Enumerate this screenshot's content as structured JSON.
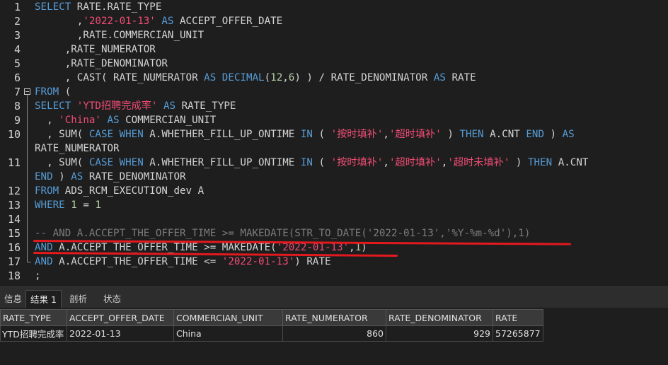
{
  "editor": {
    "line_numbers": [
      "1",
      "2",
      "3",
      "4",
      "5",
      "6",
      "7",
      "8",
      "9",
      "10",
      "",
      "11",
      "",
      "12",
      "13",
      "14",
      "15",
      "16",
      "17",
      "18"
    ],
    "lines": {
      "l1_kw": "SELECT",
      "l1_rest": " RATE.RATE_TYPE",
      "l2_pre": "       ,",
      "l2_str": "'2022-01-13'",
      "l2_as": " AS",
      "l2_rest": " ACCEPT_OFFER_DATE",
      "l3": "       ,RATE.COMMERCIAN_UNIT",
      "l4": "     ,RATE_NUMERATOR",
      "l5": "     ,RATE_DENOMINATOR",
      "l6_a": "     , CAST( RATE_NUMERATOR ",
      "l6_as": "AS",
      "l6_dec": " DECIMAL",
      "l6_b": "(",
      "l6_n1": "12",
      "l6_c": ",",
      "l6_n2": "6",
      "l6_d": ") ) / RATE_DENOMINATOR ",
      "l6_as2": "AS",
      "l6_e": " RATE",
      "l7_kw": "FROM",
      "l7_rest": " (",
      "l8_kw": "SELECT",
      "l8_str": " 'YTD招聘完成率'",
      "l8_as": " AS",
      "l8_rest": " RATE_TYPE",
      "l9_pre": "  , ",
      "l9_str": "'China'",
      "l9_as": " AS",
      "l9_rest": " COMMERCIAN_UNIT",
      "l10_a": "  , SUM( ",
      "l10_case": "CASE WHEN",
      "l10_b": " A.WHETHER_FILL_UP_ONTIME ",
      "l10_in": "IN",
      "l10_c": " ( ",
      "l10_s1": "'按时填补'",
      "l10_d": ",",
      "l10_s2": "'超时填补'",
      "l10_e": " ) ",
      "l10_then": "THEN",
      "l10_f": " A.CNT ",
      "l10_end": "END",
      "l10_g": " ) ",
      "l10_as": "AS",
      "l10w": "RATE_NUMERATOR",
      "l11_a": "  , SUM( ",
      "l11_case": "CASE WHEN",
      "l11_b": " A.WHETHER_FILL_UP_ONTIME ",
      "l11_in": "IN",
      "l11_c": " ( ",
      "l11_s1": "'按时填补'",
      "l11_d": ",",
      "l11_s2": "'超时填补'",
      "l11_e": ",",
      "l11_s3": "'超时未填补'",
      "l11_f": " ) ",
      "l11_then": "THEN",
      "l11_g": " A.CNT",
      "l11w_end": "END",
      "l11w_rest": " ) ",
      "l11w_as": "AS",
      "l11w_tail": " RATE_DENOMINATOR",
      "l12_kw": "FROM",
      "l12_rest": " ADS_RCM_EXECUTION_dev A",
      "l13_kw": "WHERE",
      "l13_sp": " ",
      "l13_n1": "1",
      "l13_eq": " = ",
      "l13_n2": "1",
      "l15": "-- AND A.ACCEPT_THE_OFFER_TIME >= MAKEDATE(STR_TO_DATE('2022-01-13','%Y-%m-%d'),1)",
      "l16_and": "AND",
      "l16_a": " A.ACCEPT_THE_OFFER_TIME >= MAKEDATE(",
      "l16_str": "'2022-01-13'",
      "l16_b": ",",
      "l16_n": "1",
      "l16_c": ")",
      "l17_and": "AND",
      "l17_a": " A.ACCEPT_THE_OFFER_TIME <= ",
      "l17_str": "'2022-01-13'",
      "l17_b": ") RATE",
      "l18": ";"
    }
  },
  "tabs": [
    {
      "label": "信息"
    },
    {
      "label": "结果 1"
    },
    {
      "label": "剖析"
    },
    {
      "label": "状态"
    }
  ],
  "results": {
    "headers": [
      "RATE_TYPE",
      "ACCEPT_OFFER_DATE",
      "COMMERCIAN_UNIT",
      "RATE_NUMERATOR",
      "RATE_DENOMINATOR",
      "RATE"
    ],
    "row": [
      "YTD招聘完成率",
      "2022-01-13",
      "China",
      "860",
      "929",
      "57265877"
    ]
  },
  "colors": {
    "annotation": "#e3191e",
    "keyword": "#569cd6",
    "string": "#f14c74"
  }
}
